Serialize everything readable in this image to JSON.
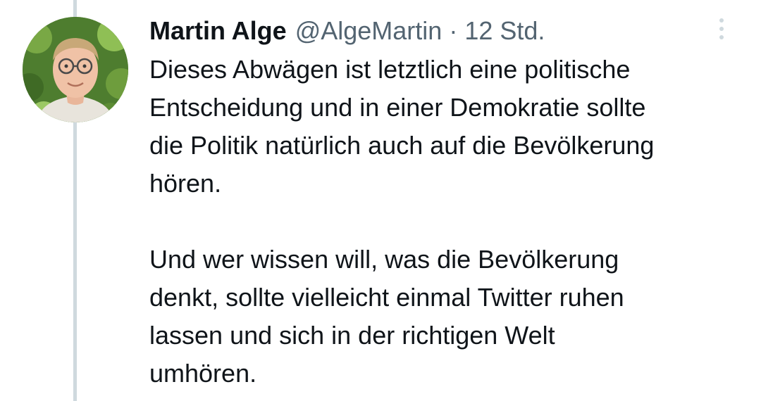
{
  "tweet": {
    "author_name": "Martin Alge",
    "handle": "@AlgeMartin",
    "separator": "·",
    "timestamp": "12 Std.",
    "more_icon": "more-vertical-icon",
    "paragraph1": [
      "Dieses Abwägen ist letztlich eine politische",
      "Entscheidung und in einer Demokratie sollte",
      "die Politik natürlich auch auf die Bevölkerung",
      "hören."
    ],
    "paragraph2": [
      "Und wer wissen will, was die Bevölkerung",
      "denkt, sollte vielleicht einmal Twitter ruhen",
      "lassen und sich in der richtigen Welt",
      "umhören."
    ]
  },
  "colors": {
    "text": "#0f1419",
    "secondary": "#536471",
    "thread_line": "#cfd9de"
  }
}
